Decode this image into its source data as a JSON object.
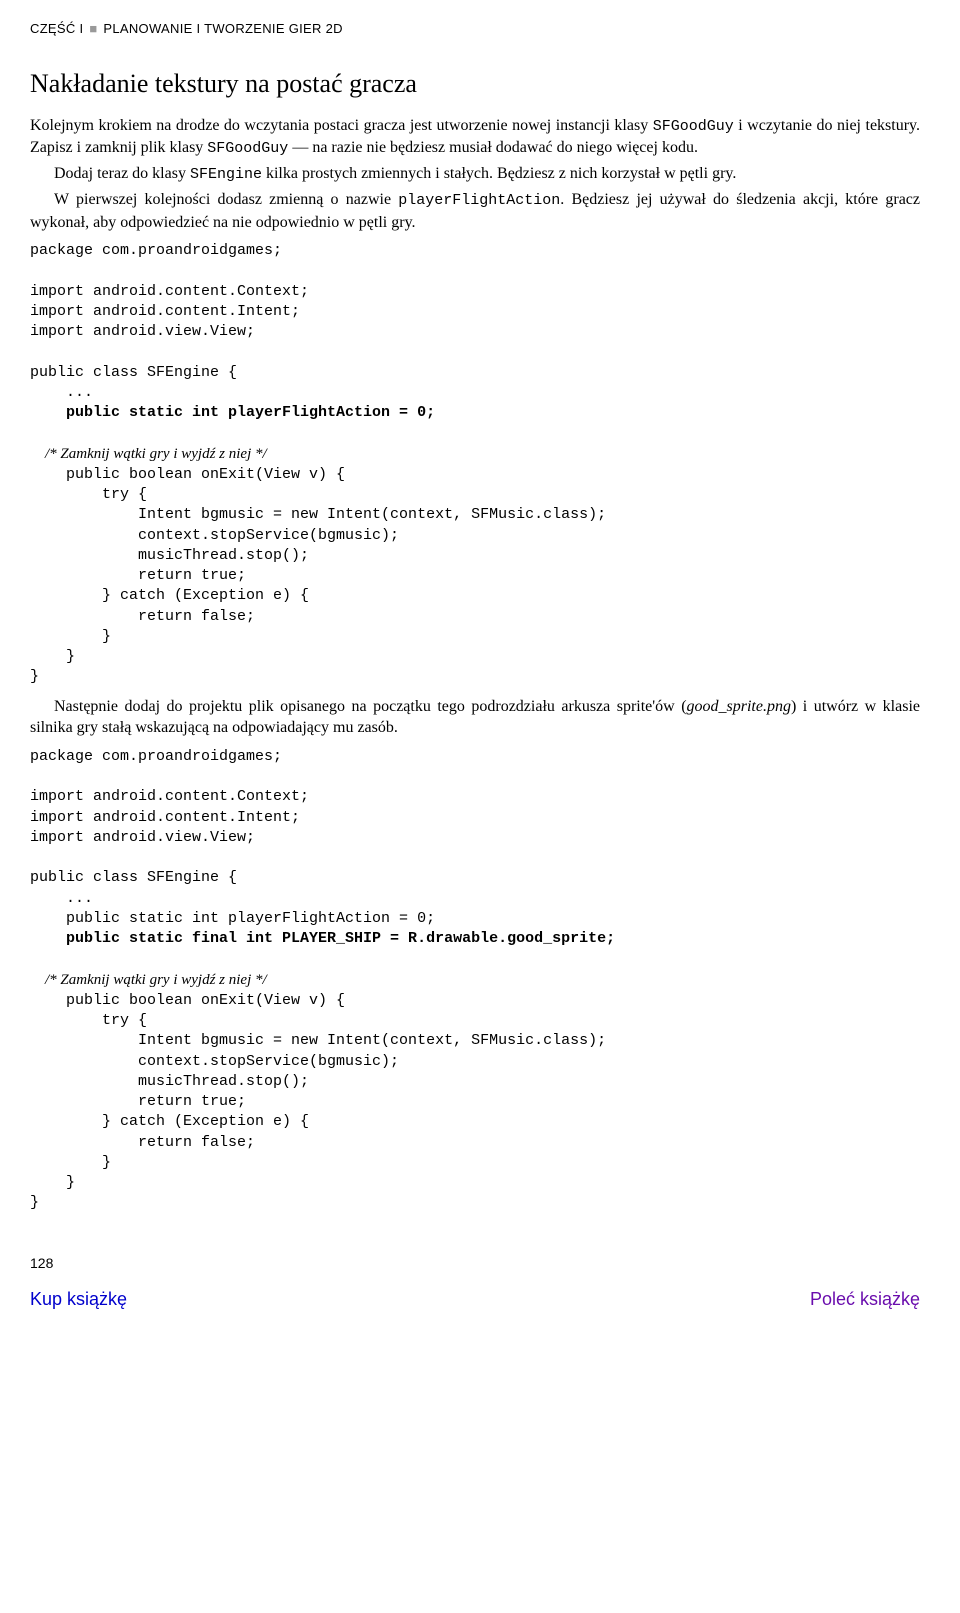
{
  "header": {
    "part": "CZĘŚĆ I",
    "square": "■",
    "title": "PLANOWANIE I TWORZENIE GIER 2D"
  },
  "section_title": "Nakładanie tekstury na postać gracza",
  "p1a": "Kolejnym krokiem na drodze do wczytania postaci gracza jest utworzenie nowej instancji klasy ",
  "p1b": "SFGoodGuy",
  "p1c": " i wczytanie do niej tekstury. Zapisz i zamknij plik klasy ",
  "p1d": "SFGoodGuy",
  "p1e": " — na razie nie będziesz musiał dodawać do niego więcej kodu.",
  "p2a": "Dodaj teraz do klasy ",
  "p2b": "SFEngine",
  "p2c": " kilka prostych zmiennych i stałych. Będziesz z nich korzystał w pętli gry.",
  "p3a": "W pierwszej kolejności dodasz zmienną o nazwie ",
  "p3b": "playerFlightAction",
  "p3c": ". Będziesz jej używał do śledzenia akcji, które gracz wykonał, aby odpowiedzieć na nie odpowiednio w pętli gry.",
  "code1": {
    "l1": "package com.proandroidgames;",
    "l2": "import android.content.Context;",
    "l3": "import android.content.Intent;",
    "l4": "import android.view.View;",
    "l5": "public class SFEngine {",
    "l6": "    ...",
    "l7": "    public static int playerFlightAction = 0;",
    "c1": "    /* Zamknij wątki gry i wyjdź z niej */",
    "l8": "    public boolean onExit(View v) {",
    "l9": "        try {",
    "l10": "            Intent bgmusic = new Intent(context, SFMusic.class);",
    "l11": "            context.stopService(bgmusic);",
    "l12": "            musicThread.stop();",
    "l13": "            return true;",
    "l14": "        } catch (Exception e) {",
    "l15": "            return false;",
    "l16": "        }",
    "l17": "    }",
    "l18": "}"
  },
  "p4a": "Następnie dodaj do projektu plik opisanego na początku tego podrozdziału arkusza sprite'ów (",
  "p4b": "good_sprite.png",
  "p4c": ") i utwórz w klasie silnika gry stałą wskazującą na odpowiadający mu zasób.",
  "code2": {
    "l1": "package com.proandroidgames;",
    "l2": "import android.content.Context;",
    "l3": "import android.content.Intent;",
    "l4": "import android.view.View;",
    "l5": "public class SFEngine {",
    "l6": "    ...",
    "l7": "    public static int playerFlightAction = 0;",
    "l7b": "    public static final int PLAYER_SHIP = R.drawable.good_sprite;",
    "c1": "    /* Zamknij wątki gry i wyjdź z niej */",
    "l8": "    public boolean onExit(View v) {",
    "l9": "        try {",
    "l10": "            Intent bgmusic = new Intent(context, SFMusic.class);",
    "l11": "            context.stopService(bgmusic);",
    "l12": "            musicThread.stop();",
    "l13": "            return true;",
    "l14": "        } catch (Exception e) {",
    "l15": "            return false;",
    "l16": "        }",
    "l17": "    }",
    "l18": "}"
  },
  "page_number": "128",
  "footer": {
    "left": "Kup książkę",
    "right": "Poleć książkę"
  }
}
